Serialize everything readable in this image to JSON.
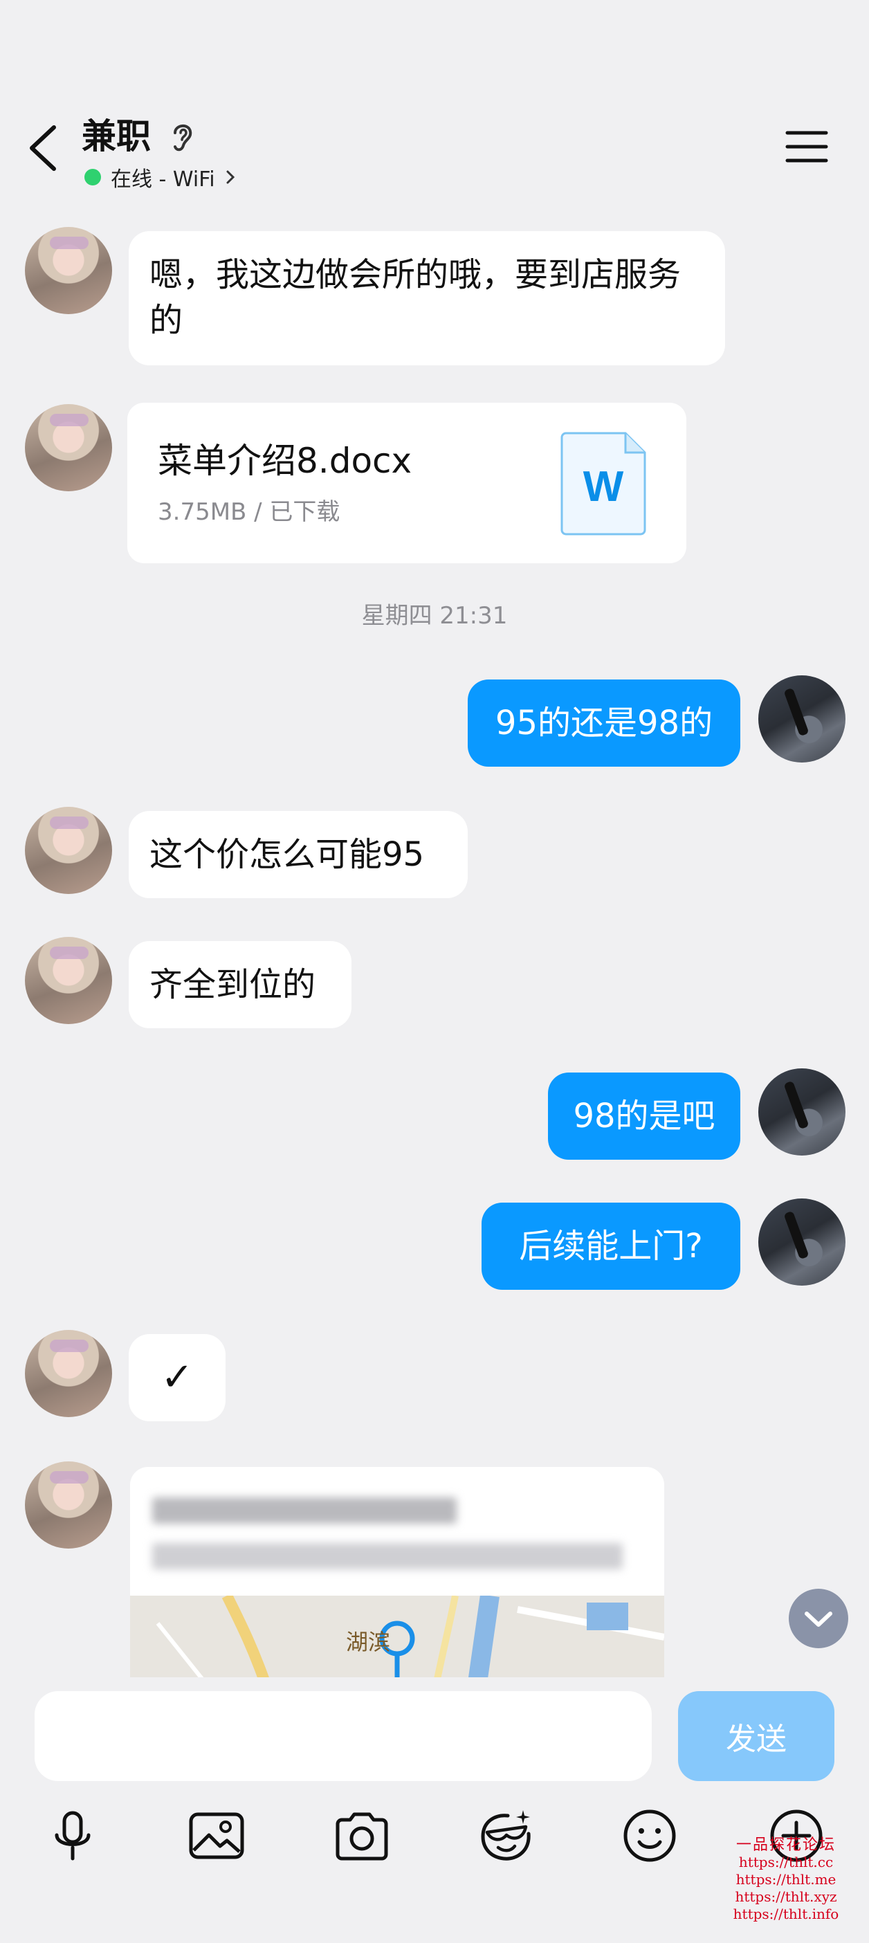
{
  "header": {
    "title": "兼职",
    "status_text": "在线 - WiFi",
    "status_color": "#2fd16f"
  },
  "messages": {
    "m1": "嗯，我这边做会所的哦，要到店服务的",
    "file": {
      "name": "菜单介绍8.docx",
      "meta": "3.75MB / 已下载",
      "icon": "word-doc-icon"
    },
    "timestamp": "星期四 21:31",
    "m2": "95的还是98的",
    "m3": "这个价怎么可能95",
    "m4": "齐全到位的",
    "m5": "98的是吧",
    "m6": "后续能上门?",
    "m7": "✓",
    "location_map_label": "湖滨"
  },
  "input": {
    "placeholder": "",
    "send_label": "发送"
  },
  "toolbar": {
    "icons": [
      "microphone-icon",
      "image-icon",
      "camera-icon",
      "sticker-icon",
      "emoji-icon",
      "plus-icon"
    ]
  },
  "watermark": {
    "title": "一品探花论坛",
    "links": [
      "https://thlt.cc",
      "https://thlt.me",
      "https://thlt.xyz",
      "https://thlt.info"
    ]
  },
  "colors": {
    "outgoing_bubble": "#0a99ff",
    "incoming_bubble": "#ffffff",
    "background": "#f0f0f2",
    "send_button": "#86c8fb"
  }
}
